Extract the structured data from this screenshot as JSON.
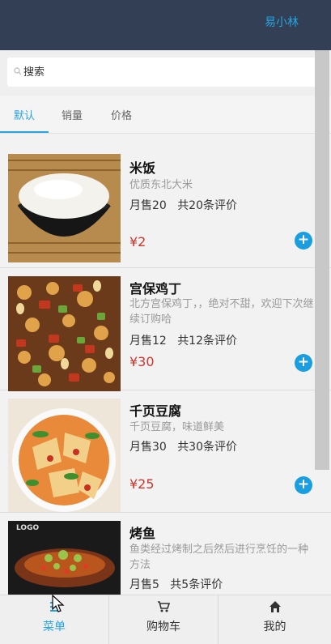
{
  "header": {
    "user": "易小林"
  },
  "search": {
    "placeholder": "搜索"
  },
  "tabs": [
    {
      "label": "默认"
    },
    {
      "label": "销量"
    },
    {
      "label": "价格"
    }
  ],
  "items": [
    {
      "name": "米饭",
      "desc": "优质东北大米",
      "sales": "月售20",
      "reviews": "共20条评价",
      "price": "¥2"
    },
    {
      "name": "宫保鸡丁",
      "desc": "北方宫保鸡丁，，绝对不甜，欢迎下次继续订购哈",
      "sales": "月售12",
      "reviews": "共12条评价",
      "price": "¥30"
    },
    {
      "name": "千页豆腐",
      "desc": "千页豆腐，味道鲜美",
      "sales": "月售30",
      "reviews": "共30条评价",
      "price": "¥25"
    },
    {
      "name": "烤鱼",
      "desc": "鱼类经过烤制之后然后进行烹饪的一种方法",
      "sales": "月售5",
      "reviews": "共5条评价",
      "price": ""
    }
  ],
  "bottom_nav": [
    {
      "label": "菜单"
    },
    {
      "label": "购物车"
    },
    {
      "label": "我的"
    }
  ],
  "images": {
    "fish_logo": "LOGO"
  },
  "colors": {
    "accent": "#27a4e0",
    "price": "#d0342c",
    "header_bg": "#323f55",
    "add_button": "#1a9ee0"
  }
}
